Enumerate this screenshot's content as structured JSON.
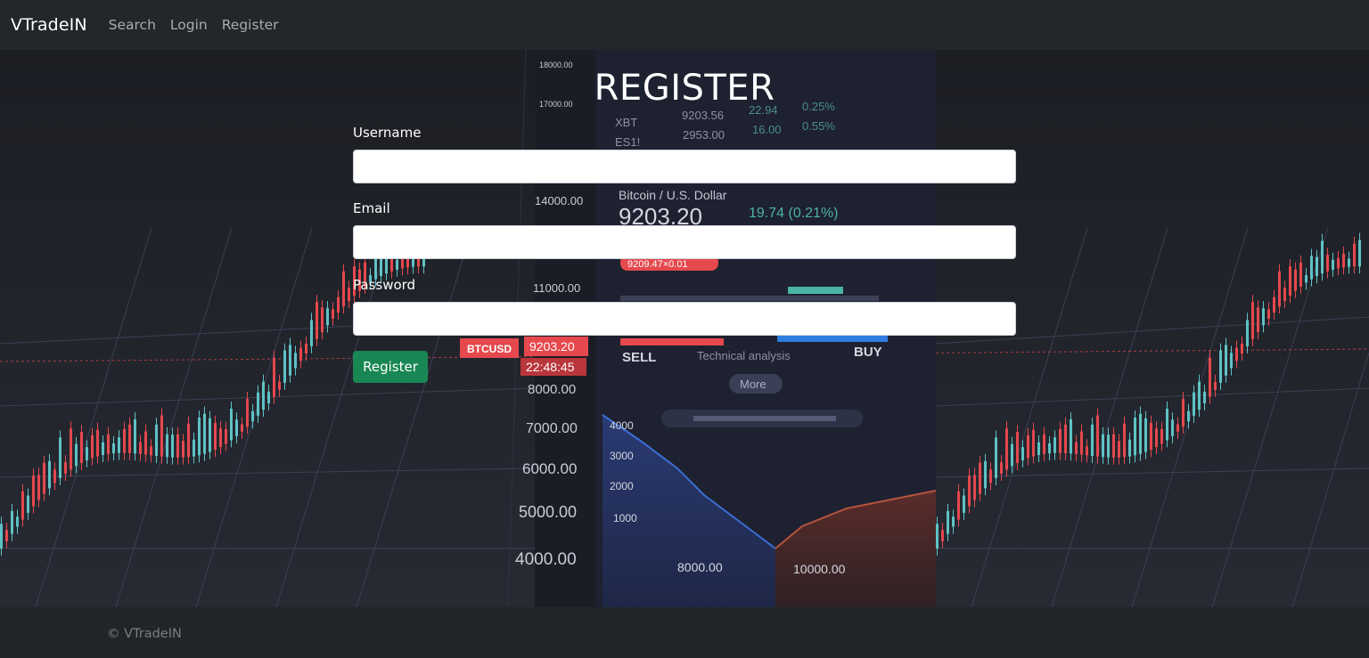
{
  "navbar": {
    "brand": "VTradeIN",
    "links": [
      "Search",
      "Login",
      "Register"
    ]
  },
  "form": {
    "title": "REGISTER",
    "fields": [
      {
        "label": "Username",
        "value": "",
        "placeholder": ""
      },
      {
        "label": "Email",
        "value": "",
        "placeholder": ""
      },
      {
        "label": "Password",
        "value": "",
        "placeholder": ""
      }
    ],
    "submit_label": "Register"
  },
  "background_photo": {
    "axis_labels": [
      "14000.00",
      "11000.00",
      "8000.00",
      "7000.00",
      "6000.00",
      "5000.00",
      "4000.00"
    ],
    "top_axis_labels": [
      "18000.00",
      "17000.00"
    ],
    "ticker_rows": [
      {
        "symbol": "XBT",
        "price": "9203.56",
        "change": "22.94",
        "pct": "0.25%"
      },
      {
        "symbol": "ES1!",
        "price": "2953.00",
        "change": "16.00",
        "pct": "0.55%"
      }
    ],
    "pair_name": "Bitcoin / U.S. Dollar",
    "price": "9203.20",
    "price_change": "19.74 (0.21%)",
    "price_tag": "9209.47×0.01",
    "symbol_tag": "BTCUSD",
    "symbol_price": "9203.20",
    "timer": "22:48:45",
    "sell_label": "SELL",
    "analysis_label": "Technical analysis",
    "buy_label": "BUY",
    "more_label": "More",
    "depth_labels": [
      "4000",
      "3000",
      "2000",
      "1000"
    ],
    "depth_x_labels": [
      "8000.00",
      "10000.00"
    ],
    "colors": {
      "up": "#5fc2c4",
      "down": "#e5484d",
      "depth_bid": "#3b6fd6",
      "depth_ask": "#b5533f",
      "buy": "#2f7de1"
    }
  },
  "footer": {
    "copyright": "© VTradeIN"
  }
}
